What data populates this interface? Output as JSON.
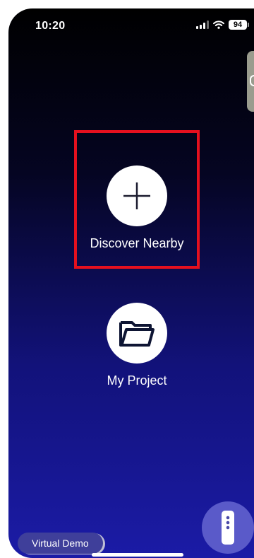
{
  "status_bar": {
    "time": "10:20",
    "battery": "94"
  },
  "main": {
    "discover": {
      "label": "Discover Nearby",
      "icon": "plus-icon"
    },
    "project": {
      "label": "My Project",
      "icon": "folder-icon"
    }
  },
  "bottom": {
    "virtual_demo_label": "Virtual Demo",
    "remote_icon": "remote-control-icon"
  },
  "colors": {
    "highlight_border": "#e5101e",
    "button_fill": "#3f3f9a",
    "fab_fill": "#5a5ac9"
  }
}
